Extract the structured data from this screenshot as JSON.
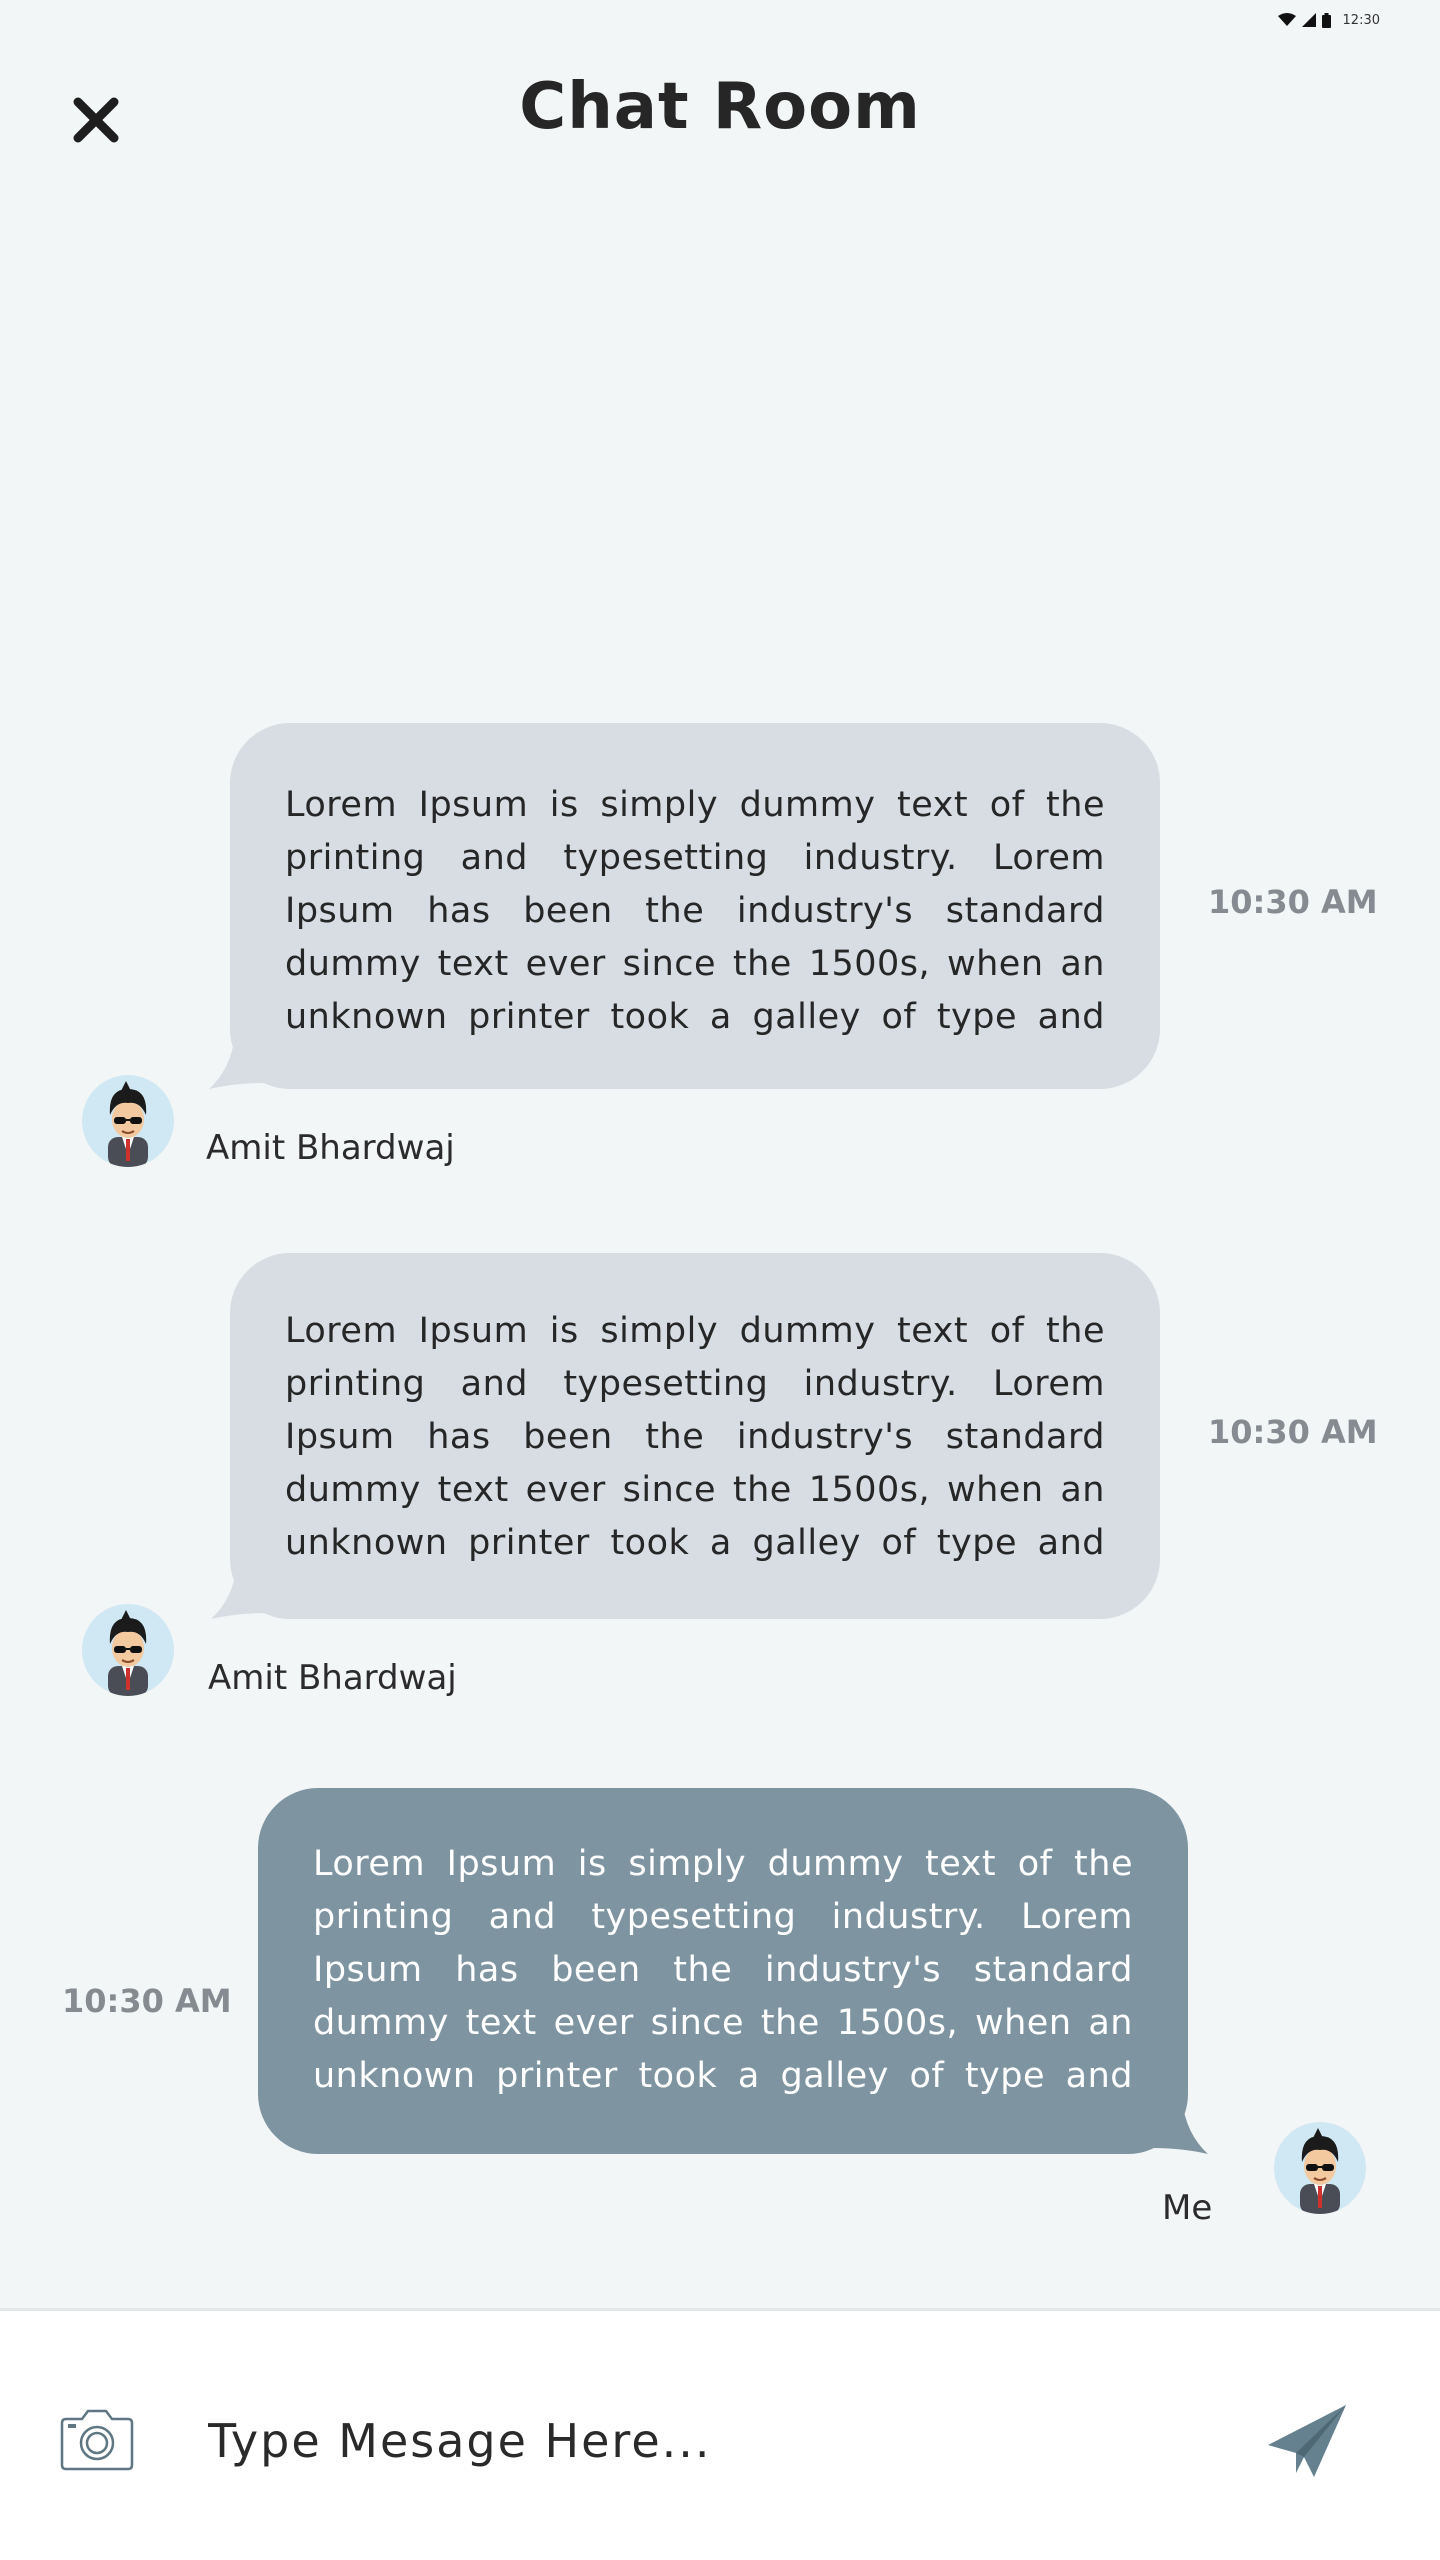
{
  "status_bar": {
    "time": "12:30",
    "icons": [
      "wifi-icon",
      "signal-icon",
      "battery-icon"
    ]
  },
  "header": {
    "title": "Chat Room",
    "close_icon": "close-icon"
  },
  "messages": [
    {
      "direction": "incoming",
      "sender": "Amit Bhardwaj",
      "text": "Lorem Ipsum is simply dummy text of the printing and typesetting industry. Lorem Ipsum has been the industry's standard dummy text ever since the 1500s, when an unknown printer took a galley of type and",
      "time": "10:30 AM"
    },
    {
      "direction": "incoming",
      "sender": "Amit Bhardwaj",
      "text": "Lorem Ipsum is simply dummy text of the printing and typesetting industry. Lorem Ipsum has been the industry's standard dummy text ever since the 1500s, when an unknown printer took a galley of type and",
      "time": "10:30 AM"
    },
    {
      "direction": "outgoing",
      "sender": "Me",
      "text": "Lorem Ipsum is simply dummy text of the printing and typesetting industry. Lorem Ipsum has been the industry's standard dummy text ever since the 1500s, when an unknown printer took a galley of type and",
      "time": "10:30 AM"
    }
  ],
  "composer": {
    "placeholder": "Type Mesage Here...",
    "camera_icon": "camera-icon",
    "send_icon": "send-icon"
  },
  "colors": {
    "background": "#f3f6f7",
    "incoming_bubble": "#d7dde2",
    "outgoing_bubble": "#7e95a1",
    "timestamp": "#858b90",
    "send_icon": "#65808e",
    "avatar_bg": "#cfe8f3"
  }
}
